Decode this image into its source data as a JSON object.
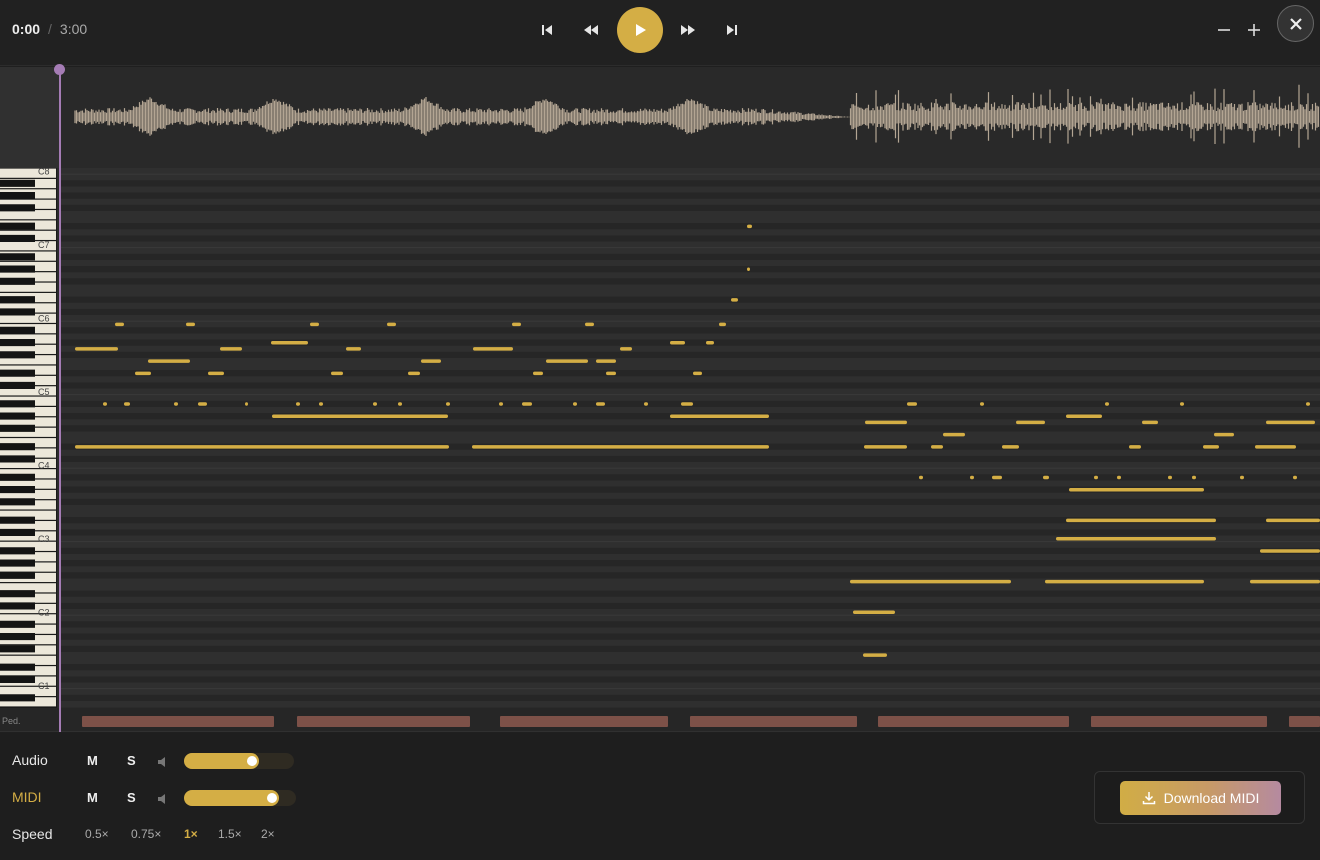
{
  "player": {
    "current_time": "0:00",
    "separator": "/",
    "duration": "3:00"
  },
  "accent_color": "#d4ae45",
  "playhead_color": "#a57cb5",
  "piano": {
    "octave_labels": [
      "C8",
      "C7",
      "C6",
      "C5",
      "C4",
      "C3",
      "C2",
      "C1"
    ]
  },
  "pedal": {
    "label": "Ped."
  },
  "tracks": [
    {
      "name": "Audio",
      "mute": "M",
      "solo": "S",
      "volume_fraction": 0.68
    },
    {
      "name": "MIDI",
      "mute": "M",
      "solo": "S",
      "volume_fraction": 0.85
    }
  ],
  "speed": {
    "label": "Speed",
    "options": [
      "0.5×",
      "0.75×",
      "1×",
      "1.5×",
      "2×"
    ],
    "selected": "1×"
  },
  "download": {
    "label": "Download MIDI"
  },
  "icons": {
    "skip_start": "skip-to-start-icon",
    "rewind": "rewind-icon",
    "play": "play-icon",
    "fast_forward": "fast-forward-icon",
    "skip_end": "skip-to-end-icon",
    "zoom_out": "minus-icon",
    "zoom_in": "plus-icon",
    "close": "close-icon",
    "volume": "speaker-icon",
    "download": "download-icon"
  }
}
